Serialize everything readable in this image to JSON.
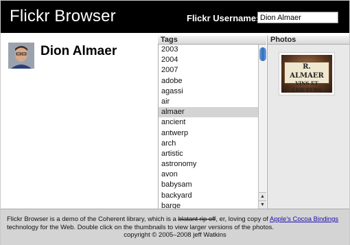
{
  "header": {
    "app_title": "Flickr Browser",
    "username_label": "Flickr Username:",
    "username_value": "Dion Almaer"
  },
  "profile": {
    "name": "Dion Almaer"
  },
  "tags": {
    "header": "Tags",
    "items": [
      "2003",
      "2004",
      "2007",
      "adobe",
      "agassi",
      "air",
      "almaer",
      "ancient",
      "antwerp",
      "arch",
      "artistic",
      "astronomy",
      "avon",
      "babysam",
      "backyard",
      "barge"
    ],
    "selected": "almaer"
  },
  "photos": {
    "header": "Photos",
    "thumb_sign_line1": "R. ALMAER",
    "thumb_sign_line2": "VINS ET LIQUEURS"
  },
  "footer": {
    "text_part1": "Flickr Browser is a demo of the Coherent library, which is a ",
    "strike_text": "blatant rip off",
    "text_part2": ", er, loving copy of ",
    "link_text": "Apple's Cocoa Bindings",
    "text_part3": " technology for the Web. Double click on the thumbnails to view larger versions of the photos.",
    "copyright": "copyright © 2005–2008 jeff Watkins"
  },
  "colors": {
    "header_bg": "#000000",
    "selection_bg": "#d4d4d4",
    "footer_bg": "#d4d4d4",
    "link": "#1a0dab",
    "scroll_thumb": "#2f6cc0"
  }
}
